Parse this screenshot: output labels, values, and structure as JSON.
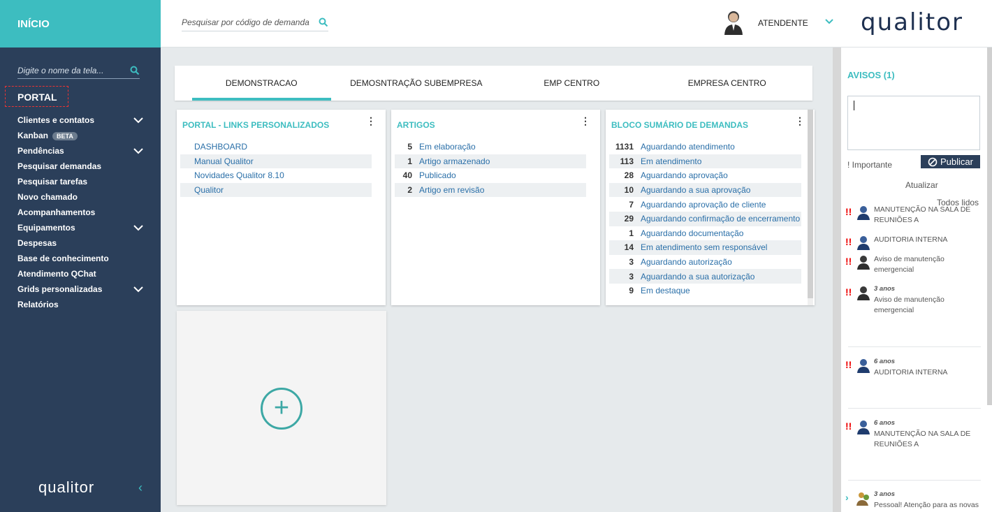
{
  "sidebar": {
    "home": "INÍCIO",
    "search_placeholder": "Digite o nome da tela...",
    "current": "PORTAL",
    "items": [
      {
        "label": "Clientes e contatos",
        "expand": true
      },
      {
        "label": "Kanban",
        "badge": "BETA"
      },
      {
        "label": "Pendências",
        "expand": true
      },
      {
        "label": "Pesquisar demandas"
      },
      {
        "label": "Pesquisar tarefas"
      },
      {
        "label": "Novo chamado"
      },
      {
        "label": "Acompanhamentos"
      },
      {
        "label": "Equipamentos",
        "expand": true
      },
      {
        "label": "Despesas"
      },
      {
        "label": "Base de conhecimento"
      },
      {
        "label": "Atendimento QChat"
      },
      {
        "label": "Grids personalizadas",
        "expand": true
      },
      {
        "label": "Relatórios"
      }
    ],
    "logo": "qualitor"
  },
  "topbar": {
    "search_placeholder": "Pesquisar por código de demanda",
    "user": "ATENDENTE",
    "logo": "qualitor"
  },
  "tabs": [
    {
      "label": "DEMONSTRACAO",
      "active": true
    },
    {
      "label": "DEMOSNTRAÇÃO SUBEMPRESA"
    },
    {
      "label": "EMP CENTRO"
    },
    {
      "label": "EMPRESA CENTRO"
    }
  ],
  "widgets": {
    "links": {
      "title": "PORTAL - LINKS PERSONALIZADOS",
      "items": [
        "DASHBOARD",
        "Manual Qualitor",
        "Novidades Qualitor 8.10",
        "Qualitor"
      ]
    },
    "artigos": {
      "title": "ARTIGOS",
      "items": [
        {
          "count": "5",
          "label": "Em elaboração"
        },
        {
          "count": "1",
          "label": "Artigo armazenado"
        },
        {
          "count": "40",
          "label": "Publicado"
        },
        {
          "count": "2",
          "label": "Artigo em revisão"
        }
      ]
    },
    "demandas": {
      "title": "BLOCO SUMÁRIO DE DEMANDAS",
      "items": [
        {
          "count": "1131",
          "label": "Aguardando atendimento"
        },
        {
          "count": "113",
          "label": "Em atendimento"
        },
        {
          "count": "28",
          "label": "Aguardando aprovação"
        },
        {
          "count": "10",
          "label": "Aguardando a sua aprovação"
        },
        {
          "count": "7",
          "label": "Aguardando aprovação de cliente"
        },
        {
          "count": "29",
          "label": "Aguardando confirmação de encerramento"
        },
        {
          "count": "1",
          "label": "Aguardando documentação"
        },
        {
          "count": "14",
          "label": "Em atendimento sem responsável"
        },
        {
          "count": "3",
          "label": "Aguardando autorização"
        },
        {
          "count": "3",
          "label": "Aguardando a sua autorização"
        },
        {
          "count": "9",
          "label": "Em destaque"
        }
      ]
    }
  },
  "avisos": {
    "title": "AVISOS (1)",
    "important": "! Importante",
    "publish": "Publicar",
    "update": "Atualizar",
    "all_read": "Todos lidos",
    "notices": [
      {
        "time": "",
        "text": "MANUTENÇÃO NA SALA DE REUNIÕES A"
      },
      {
        "time": "",
        "text": "AUDITORIA INTERNA"
      },
      {
        "time": "",
        "text": "Aviso de manutenção emergencial"
      },
      {
        "time": "3 anos",
        "text": "Aviso de manutenção emergencial"
      },
      {
        "time": "6 anos",
        "text": "AUDITORIA INTERNA"
      },
      {
        "time": "6 anos",
        "text": "MANUTENÇÃO NA SALA DE REUNIÕES A"
      },
      {
        "time": "3 anos",
        "text": "Pessoal! Atenção para as novas"
      }
    ]
  },
  "colors": {
    "accent": "#3dbdc0",
    "sidebar": "#2b3f5a",
    "link": "#2a6fa8",
    "alert": "#e00000"
  }
}
